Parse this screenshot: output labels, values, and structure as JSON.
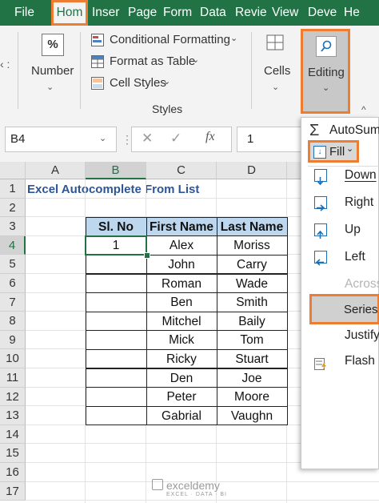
{
  "tabs": [
    "File",
    "Hom",
    "Inser",
    "Page",
    "Form",
    "Data",
    "Revie",
    "View",
    "Deve",
    "He"
  ],
  "ribbon": {
    "number_label": "Number",
    "number_symbol": "%",
    "conditional_formatting": "Conditional Formatting",
    "format_as_table": "Format as Table",
    "cell_styles": "Cell Styles",
    "styles_group": "Styles",
    "cells_label": "Cells",
    "editing_label": "Editing"
  },
  "formula_bar": {
    "name_box": "B4",
    "fx_label": "fx",
    "value": "1"
  },
  "columns": [
    "A",
    "B",
    "C",
    "D"
  ],
  "rows": [
    "1",
    "2",
    "3",
    "4",
    "5",
    "6",
    "7",
    "8",
    "9",
    "10",
    "11",
    "12",
    "13",
    "14",
    "15",
    "16",
    "17"
  ],
  "sheet": {
    "title": "Excel Autocomplete From List",
    "headers": [
      "Sl. No",
      "First Name",
      "Last Name"
    ],
    "data": [
      [
        "1",
        "Alex",
        "Moriss"
      ],
      [
        "",
        "John",
        "Carry"
      ],
      [
        "",
        "Roman",
        "Wade"
      ],
      [
        "",
        "Ben",
        "Smith"
      ],
      [
        "",
        "Mitchel",
        "Baily"
      ],
      [
        "",
        "Mick",
        "Tom"
      ],
      [
        "",
        "Ricky",
        "Stuart"
      ],
      [
        "",
        "Den",
        "Joe"
      ],
      [
        "",
        "Peter",
        "Moore"
      ],
      [
        "",
        "Gabrial",
        "Vaughn"
      ]
    ]
  },
  "menu": {
    "autosum": "AutoSum",
    "fill": "Fill",
    "down": "Down",
    "right": "Right",
    "up": "Up",
    "left": "Left",
    "across": "Across",
    "series": "Series.",
    "justify": "Justify",
    "flash_fill": "Flash F"
  },
  "watermark": "exceldemy",
  "watermark_sub": "EXCEL · DATA · BI",
  "colors": {
    "excel_green": "#217346",
    "highlight_orange": "#ed7d31",
    "title_blue": "#2e5597"
  }
}
